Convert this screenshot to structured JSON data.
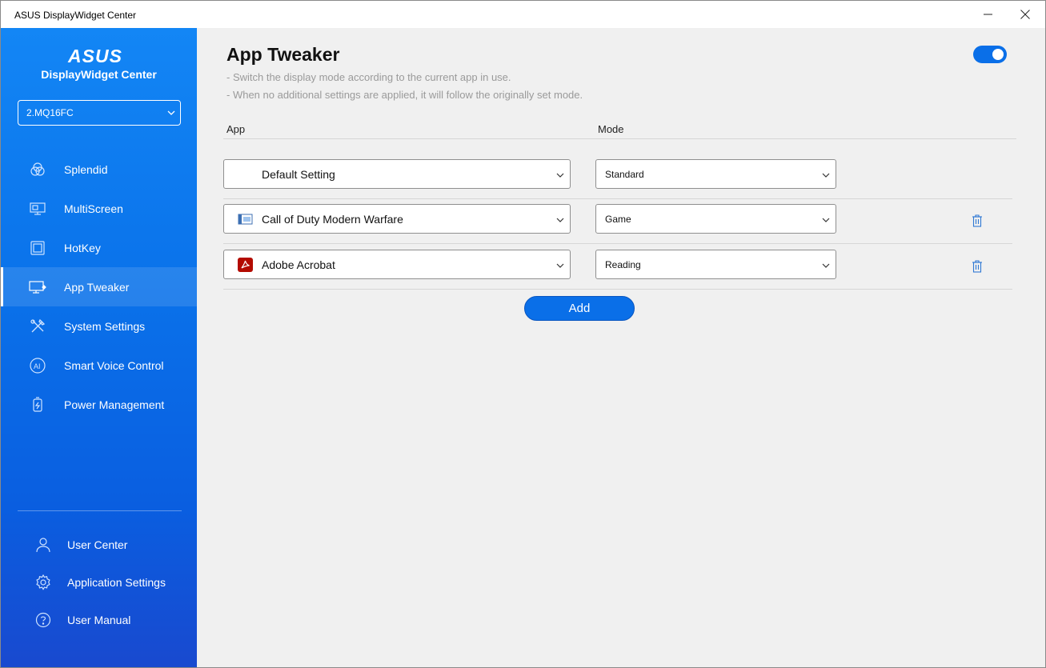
{
  "window": {
    "title": "ASUS DisplayWidget Center"
  },
  "sidebar": {
    "logo": "ASUS",
    "brand_subtitle": "DisplayWidget Center",
    "monitor_select": "2.MQ16FC",
    "items": [
      {
        "label": "Splendid",
        "icon": "splendid-icon",
        "active": false
      },
      {
        "label": "MultiScreen",
        "icon": "multiscreen-icon",
        "active": false
      },
      {
        "label": "HotKey",
        "icon": "hotkey-icon",
        "active": false
      },
      {
        "label": "App Tweaker",
        "icon": "app-tweaker-icon",
        "active": true
      },
      {
        "label": "System Settings",
        "icon": "system-settings-icon",
        "active": false
      },
      {
        "label": "Smart Voice Control",
        "icon": "ai-voice-icon",
        "active": false
      },
      {
        "label": "Power Management",
        "icon": "power-management-icon",
        "active": false
      }
    ],
    "bottom_items": [
      {
        "label": "User Center",
        "icon": "user-icon"
      },
      {
        "label": "Application Settings",
        "icon": "gear-icon"
      },
      {
        "label": "User Manual",
        "icon": "help-icon"
      }
    ]
  },
  "main": {
    "title": "App Tweaker",
    "description": [
      "- Switch the display mode according to the current app in use.",
      "- When no additional settings are applied, it will follow the originally set mode."
    ],
    "enabled": true,
    "columns": {
      "app": "App",
      "mode": "Mode"
    },
    "rows": [
      {
        "app": "Default Setting",
        "mode": "Standard",
        "app_icon": "none",
        "deletable": false
      },
      {
        "app": "Call of Duty Modern Warfare",
        "mode": "Game",
        "app_icon": "game-app-icon",
        "deletable": true
      },
      {
        "app": "Adobe Acrobat",
        "mode": "Reading",
        "app_icon": "acrobat-icon",
        "deletable": true
      }
    ],
    "add_label": "Add"
  },
  "colors": {
    "accent": "#0a6fe8",
    "sidebar_top": "#1386f5",
    "sidebar_bottom": "#1949cf",
    "background": "#f0f0f0"
  }
}
